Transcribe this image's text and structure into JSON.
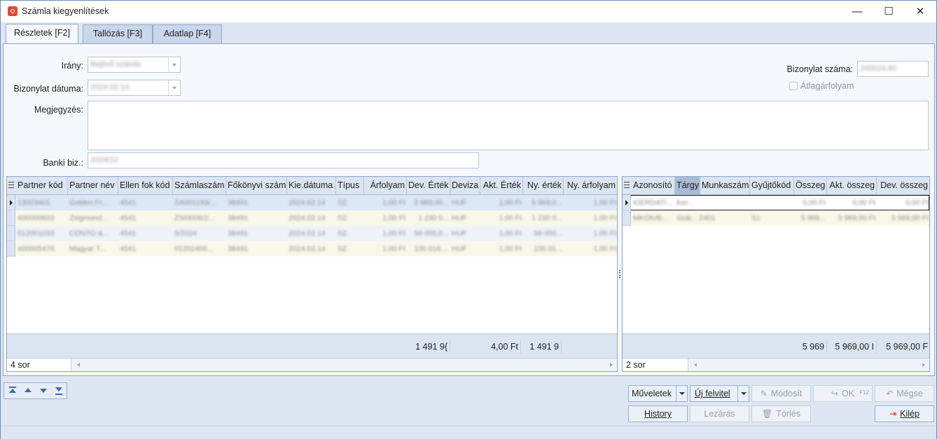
{
  "window": {
    "title": "Számla kiegyenlítések",
    "controls": {
      "minimize": "—",
      "maximize": "☐",
      "close": "✕"
    }
  },
  "tabs": [
    {
      "label": "Részletek [F2]",
      "active": true
    },
    {
      "label": "Tallózás [F3]",
      "active": false
    },
    {
      "label": "Adatlap [F4]",
      "active": false
    }
  ],
  "form": {
    "irany_label": "Irány:",
    "irany_value": "Bejövő számla",
    "datum_label": "Bizonylat dátuma:",
    "datum_value": "2024.02.14.",
    "megjegyzes_label": "Megjegyzés:",
    "megjegyzes_value": "",
    "banki_label": "Banki biz.:",
    "banki_value": "2024/22",
    "bizonylat_szama_label": "Bizonylat száma:",
    "bizonylat_szama_value": "240024.80",
    "atlagarfolyam_label": "Átlagárfolyam",
    "atlagarfolyam_checked": false
  },
  "left_grid": {
    "columns": [
      "Partner kód",
      "Partner név",
      "Ellen fok kód",
      "Számlaszám",
      "Főkönyvi szám",
      "Kie.dátuma",
      "Típus",
      "Árfolyam",
      "Dev. Érték",
      "Deviza",
      "Akt. Érték",
      "Ny. érték",
      "Ny. árfolyam"
    ],
    "rows": [
      [
        "13003401",
        "Golden Fr...",
        "4541",
        "SA001193/...",
        "38491",
        "2024.02.14",
        "SZ",
        "1,00 Ft",
        "5 969,00...",
        "HUF",
        "1,00 Ft",
        "5 969,0...",
        "1,00 Ft"
      ],
      [
        "400000603",
        "Zsigmond...",
        "4541",
        "ZSI0006/2...",
        "38491",
        "2024.02.14",
        "SZ",
        "1,00 Ft",
        "1 230 0...",
        "HUF",
        "1,00 Ft",
        "1 230 0...",
        "1,00 Ft"
      ],
      [
        "012001033",
        "CONTO &...",
        "4541",
        "5/2024",
        "38491",
        "2024.02.14",
        "SZ",
        "1,00 Ft",
        "56 000,0...",
        "HUF",
        "1,00 Ft",
        "56 000...",
        "1,00 Ft"
      ],
      [
        "400005476",
        "Magyar T...",
        "4541",
        "01202400...",
        "38491",
        "2024.02.14",
        "SZ",
        "1,00 Ft",
        "100 016,...",
        "HUF",
        "1,00 Ft",
        "100 01...",
        "1,00 Ft"
      ]
    ],
    "footer": {
      "dev_ertek_sum": "1 491 9{",
      "akt_ertek_sum": "4,00 Ft",
      "ny_ertek_sum": "1 491 9"
    },
    "row_count": "4 sor"
  },
  "right_grid": {
    "columns": [
      "Azonosító",
      "Tárgy",
      "Munkaszám",
      "Gyűjtőkód",
      "Összeg",
      "Akt. összeg",
      "Dev. összeg"
    ],
    "rows": [
      [
        "KIERDAT/...",
        "Ker...",
        "",
        "",
        "0,00 Ft",
        "0,00 Ft",
        "0,00 Ft"
      ],
      [
        "MKOK/B...",
        "Szál... 2401",
        "",
        "S1",
        "5 969...",
        "5 969,00 Ft",
        "5 969,00 Ft"
      ]
    ],
    "footer": {
      "osszeg_sum": "5 969",
      "akt_osszeg_sum": "5 969,00 I",
      "dev_osszeg_sum": "5 969,00 F"
    },
    "row_count": "2 sor"
  },
  "buttons": {
    "muveletek": "Műveletek",
    "uj_felvitel": "Új felvitel",
    "modosit": "Módosít",
    "ok": "OK",
    "ok_shortcut": "F12",
    "megse": "Mégse",
    "history": "History",
    "lezaras": "Lezárás",
    "torles": "Törlés",
    "kilep": "Kilép"
  },
  "colors": {
    "accent": "#3c6aa8",
    "header_bg": "#dbe5f1",
    "selected_row": "#dce8f7",
    "alt_row": "#f9f8e8"
  }
}
